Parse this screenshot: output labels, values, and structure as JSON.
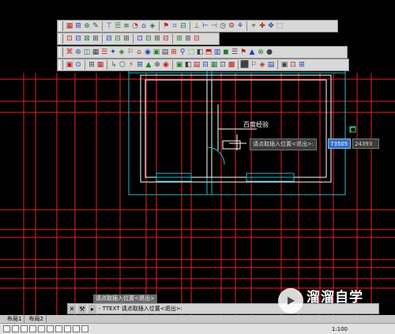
{
  "toolbars": [
    [
      "▦",
      "⊞",
      "⊕",
      "✎",
      "|",
      "⊤",
      "☰",
      "≡",
      "◔",
      "⌂",
      "◈",
      "|",
      "⚑",
      "⌗",
      "⊟",
      "|",
      "⊥",
      "⊢",
      "⊣",
      "◷",
      "⚙",
      "⚘",
      "|",
      "⌖",
      "✚",
      "✥",
      "⬚"
    ],
    [
      "⊡",
      "⊟",
      "⊠",
      "⊞",
      "|",
      "⊟",
      "⊟",
      "⊞",
      "|",
      "⊡",
      "⊟",
      "⊞",
      "⊟",
      "|",
      "⊞",
      "⊞",
      "⊟"
    ],
    [
      "⌘",
      "⊛",
      "◫",
      "▦",
      "☰",
      "✦",
      "◈",
      "⚐",
      "⌂",
      "◉",
      "▣",
      "▤",
      "⊞",
      "⚲",
      "⬚",
      "◧",
      "⬒",
      "▥",
      "◼",
      "☰",
      "⚑",
      "▲",
      "⊗",
      "●"
    ],
    [
      "▣",
      "⊙",
      "|",
      "⊞",
      "▦",
      "|",
      "↳",
      "⬡",
      "⚡",
      "⊞",
      "▲",
      "⊕",
      "◉",
      "|",
      "▣",
      "◧",
      "▤",
      "⊟",
      "▦",
      "⊡",
      "▩",
      "|",
      "⬛",
      "⚐",
      "◈",
      "▤",
      "|",
      "▣",
      "⊡",
      "⊞"
    ]
  ],
  "drawing": {
    "text_label": "百度经验"
  },
  "prompt": {
    "tooltip": "请点取插入位置<退出>:",
    "x_value": "73505",
    "y_value": "24393"
  },
  "command": {
    "history": "请点取插入位置<退出>",
    "line": "- TTEXT 请点取插入位置<退出>:"
  },
  "layout_tabs": [
    "布局1",
    "布局2"
  ],
  "status": {
    "scale": "1:100"
  },
  "watermark": {
    "title": "溜溜自学",
    "url": "zixue.3d66.com"
  },
  "colors": {
    "grid": "#e8202a",
    "walls": "#ffffff",
    "cyan": "#2ab8c8",
    "accent": "#2f6fd0"
  }
}
